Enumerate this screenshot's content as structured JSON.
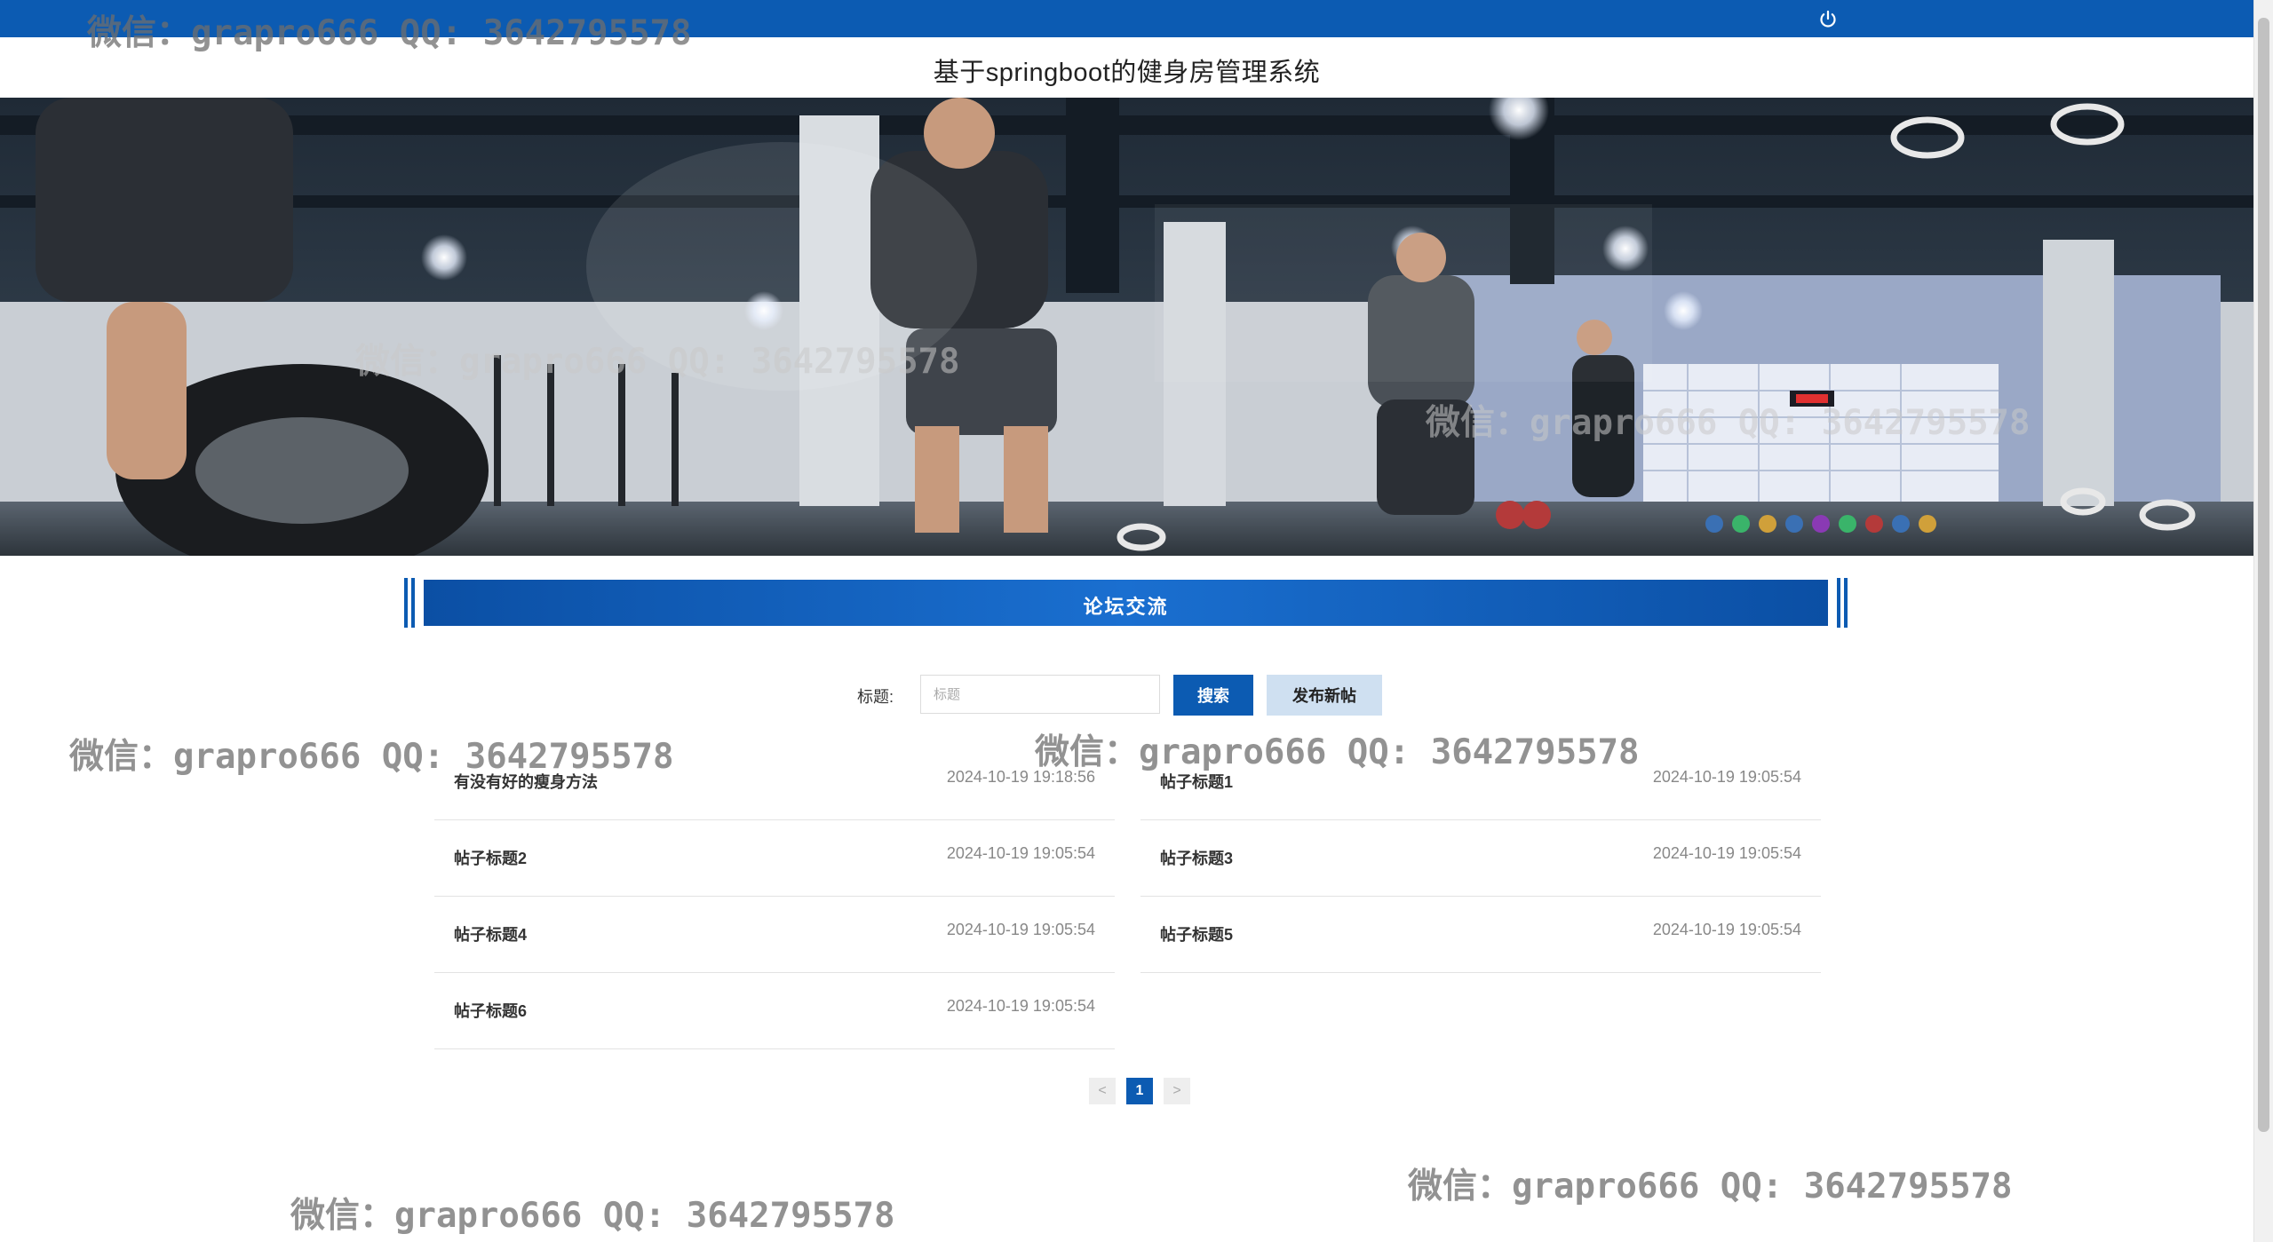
{
  "header": {
    "site_title": "基于springboot的健身房管理系统",
    "logout_icon": "power-icon"
  },
  "banner": {
    "description_icon": "gym-banner-image"
  },
  "section": {
    "title": "论坛交流"
  },
  "search": {
    "label": "标题:",
    "placeholder": "标题",
    "value": "",
    "search_button": "搜索",
    "new_post_button": "发布新帖"
  },
  "posts": [
    {
      "title": "有没有好的瘦身方法",
      "time": "2024-10-19 19:18:56"
    },
    {
      "title": "帖子标题1",
      "time": "2024-10-19 19:05:54"
    },
    {
      "title": "帖子标题2",
      "time": "2024-10-19 19:05:54"
    },
    {
      "title": "帖子标题3",
      "time": "2024-10-19 19:05:54"
    },
    {
      "title": "帖子标题4",
      "time": "2024-10-19 19:05:54"
    },
    {
      "title": "帖子标题5",
      "time": "2024-10-19 19:05:54"
    },
    {
      "title": "帖子标题6",
      "time": "2024-10-19 19:05:54"
    }
  ],
  "pagination": {
    "prev": "<",
    "current": "1",
    "next": ">"
  },
  "watermark": {
    "text": "微信：grapro666 QQ: 3642795578"
  },
  "colors": {
    "primary": "#0c5bb2",
    "secondary_button": "#cfe0f1"
  }
}
